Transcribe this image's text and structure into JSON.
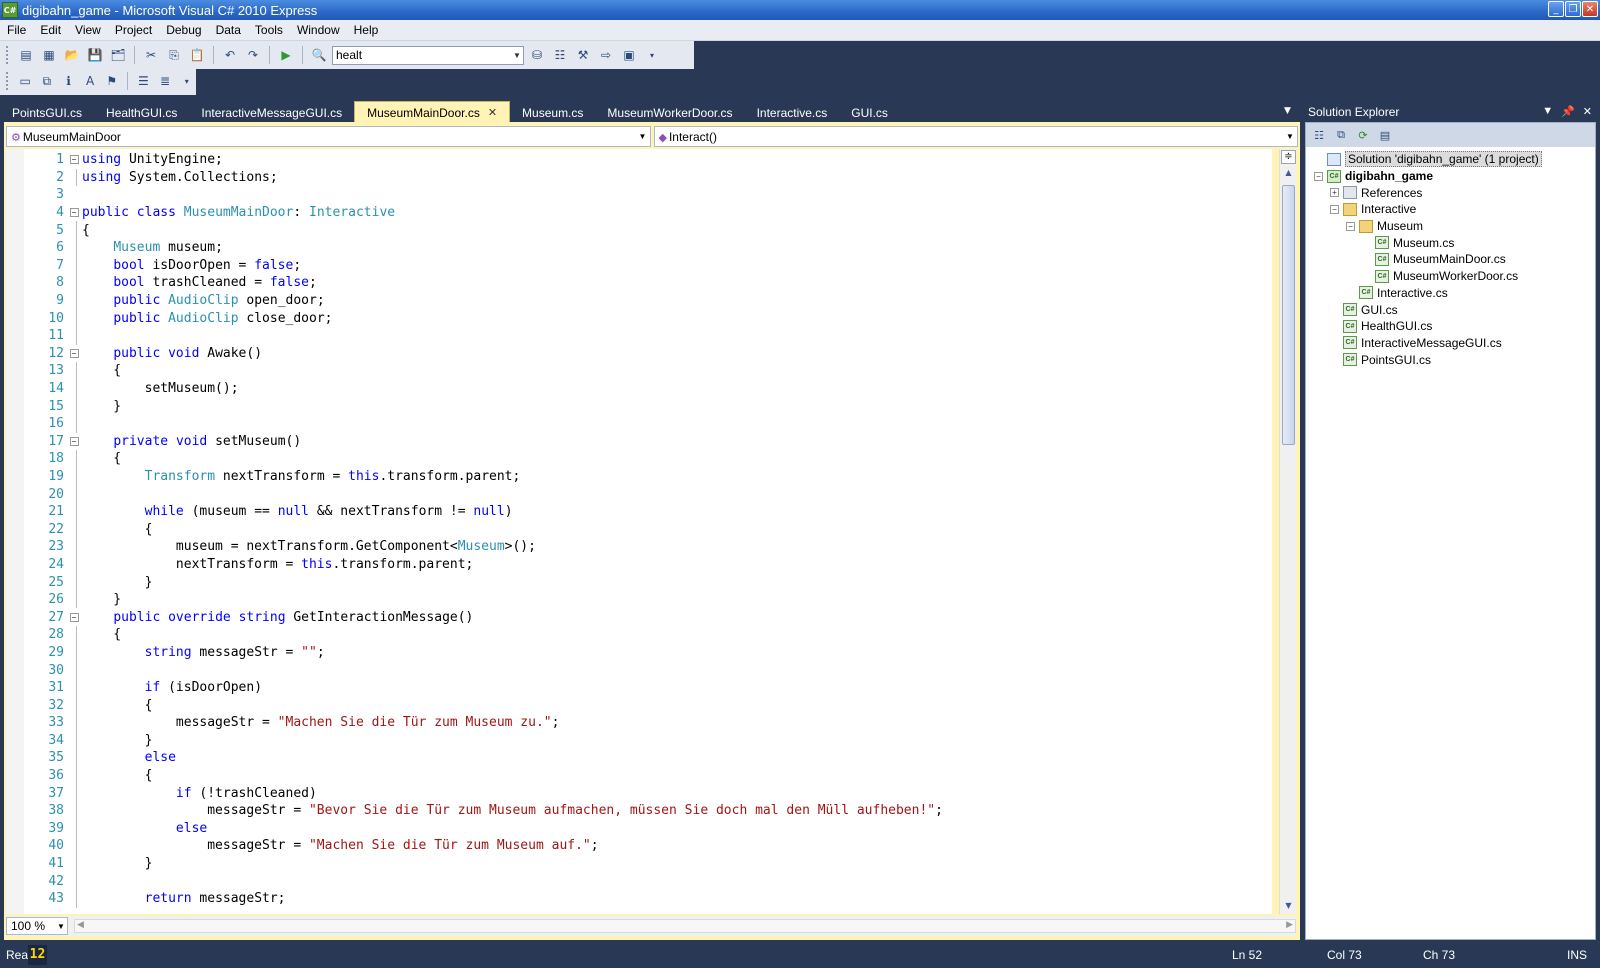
{
  "window": {
    "title": "digibahn_game - Microsoft Visual C# 2010 Express",
    "icon_label": "C#",
    "controls": [
      "minimize-icon",
      "maximize-icon",
      "close-icon"
    ]
  },
  "menu": [
    "File",
    "Edit",
    "View",
    "Project",
    "Debug",
    "Data",
    "Tools",
    "Window",
    "Help"
  ],
  "toolbar": {
    "find_combo_value": "healt"
  },
  "tabs": [
    {
      "label": "PointsGUI.cs",
      "active": false
    },
    {
      "label": "HealthGUI.cs",
      "active": false
    },
    {
      "label": "InteractiveMessageGUI.cs",
      "active": false
    },
    {
      "label": "MuseumMainDoor.cs",
      "active": true
    },
    {
      "label": "Museum.cs",
      "active": false
    },
    {
      "label": "MuseumWorkerDoor.cs",
      "active": false
    },
    {
      "label": "Interactive.cs",
      "active": false
    },
    {
      "label": "GUI.cs",
      "active": false
    }
  ],
  "navbar": {
    "type_combo": "MuseumMainDoor",
    "member_combo": "Interact()"
  },
  "colors": {
    "keyword": "#0000ff",
    "type": "#2b91af",
    "string": "#a31515",
    "line_number": "#2b91af",
    "chrome": "#293955",
    "active_tab": "#fff3b5"
  },
  "code": [
    {
      "n": "1",
      "fold": "box",
      "tokens": [
        {
          "t": "using",
          "c": "kw"
        },
        {
          "t": " UnityEngine;"
        }
      ]
    },
    {
      "n": "2",
      "fold": "line",
      "tokens": [
        {
          "t": "using",
          "c": "kw"
        },
        {
          "t": " System.Collections;"
        }
      ]
    },
    {
      "n": "3",
      "fold": "",
      "tokens": []
    },
    {
      "n": "4",
      "fold": "box",
      "tokens": [
        {
          "t": "public",
          "c": "kw"
        },
        {
          "t": " "
        },
        {
          "t": "class",
          "c": "kw"
        },
        {
          "t": " "
        },
        {
          "t": "MuseumMainDoor",
          "c": "ty"
        },
        {
          "t": ": "
        },
        {
          "t": "Interactive",
          "c": "ty"
        }
      ]
    },
    {
      "n": "5",
      "fold": "line",
      "tokens": [
        {
          "t": "{"
        }
      ]
    },
    {
      "n": "6",
      "fold": "line",
      "tokens": [
        {
          "t": "    "
        },
        {
          "t": "Museum",
          "c": "ty"
        },
        {
          "t": " museum;"
        }
      ]
    },
    {
      "n": "7",
      "fold": "line",
      "tokens": [
        {
          "t": "    "
        },
        {
          "t": "bool",
          "c": "kw"
        },
        {
          "t": " isDoorOpen = "
        },
        {
          "t": "false",
          "c": "kw"
        },
        {
          "t": ";"
        }
      ]
    },
    {
      "n": "8",
      "fold": "line",
      "tokens": [
        {
          "t": "    "
        },
        {
          "t": "bool",
          "c": "kw"
        },
        {
          "t": " trashCleaned = "
        },
        {
          "t": "false",
          "c": "kw"
        },
        {
          "t": ";"
        }
      ]
    },
    {
      "n": "9",
      "fold": "line",
      "tokens": [
        {
          "t": "    "
        },
        {
          "t": "public",
          "c": "kw"
        },
        {
          "t": " "
        },
        {
          "t": "AudioClip",
          "c": "ty"
        },
        {
          "t": " open_door;"
        }
      ]
    },
    {
      "n": "10",
      "fold": "line",
      "tokens": [
        {
          "t": "    "
        },
        {
          "t": "public",
          "c": "kw"
        },
        {
          "t": " "
        },
        {
          "t": "AudioClip",
          "c": "ty"
        },
        {
          "t": " close_door;"
        }
      ]
    },
    {
      "n": "11",
      "fold": "line",
      "tokens": []
    },
    {
      "n": "12",
      "fold": "box",
      "tokens": [
        {
          "t": "    "
        },
        {
          "t": "public",
          "c": "kw"
        },
        {
          "t": " "
        },
        {
          "t": "void",
          "c": "kw"
        },
        {
          "t": " Awake()"
        }
      ]
    },
    {
      "n": "13",
      "fold": "line",
      "tokens": [
        {
          "t": "    {"
        }
      ]
    },
    {
      "n": "14",
      "fold": "line",
      "tokens": [
        {
          "t": "        setMuseum();"
        }
      ]
    },
    {
      "n": "15",
      "fold": "line",
      "tokens": [
        {
          "t": "    }"
        }
      ]
    },
    {
      "n": "16",
      "fold": "line",
      "tokens": []
    },
    {
      "n": "17",
      "fold": "box",
      "tokens": [
        {
          "t": "    "
        },
        {
          "t": "private",
          "c": "kw"
        },
        {
          "t": " "
        },
        {
          "t": "void",
          "c": "kw"
        },
        {
          "t": " setMuseum()"
        }
      ]
    },
    {
      "n": "18",
      "fold": "line",
      "tokens": [
        {
          "t": "    {"
        }
      ]
    },
    {
      "n": "19",
      "fold": "line",
      "tokens": [
        {
          "t": "        "
        },
        {
          "t": "Transform",
          "c": "ty"
        },
        {
          "t": " nextTransform = "
        },
        {
          "t": "this",
          "c": "kw"
        },
        {
          "t": ".transform.parent;"
        }
      ]
    },
    {
      "n": "20",
      "fold": "line",
      "tokens": []
    },
    {
      "n": "21",
      "fold": "line",
      "tokens": [
        {
          "t": "        "
        },
        {
          "t": "while",
          "c": "kw"
        },
        {
          "t": " (museum == "
        },
        {
          "t": "null",
          "c": "kw"
        },
        {
          "t": " && nextTransform != "
        },
        {
          "t": "null",
          "c": "kw"
        },
        {
          "t": ")"
        }
      ]
    },
    {
      "n": "22",
      "fold": "line",
      "tokens": [
        {
          "t": "        {"
        }
      ]
    },
    {
      "n": "23",
      "fold": "line",
      "tokens": [
        {
          "t": "            museum = nextTransform.GetComponent<"
        },
        {
          "t": "Museum",
          "c": "ty"
        },
        {
          "t": ">();"
        }
      ]
    },
    {
      "n": "24",
      "fold": "line",
      "tokens": [
        {
          "t": "            nextTransform = "
        },
        {
          "t": "this",
          "c": "kw"
        },
        {
          "t": ".transform.parent;"
        }
      ]
    },
    {
      "n": "25",
      "fold": "line",
      "tokens": [
        {
          "t": "        }"
        }
      ]
    },
    {
      "n": "26",
      "fold": "line",
      "tokens": [
        {
          "t": "    }"
        }
      ]
    },
    {
      "n": "27",
      "fold": "box",
      "tokens": [
        {
          "t": "    "
        },
        {
          "t": "public",
          "c": "kw"
        },
        {
          "t": " "
        },
        {
          "t": "override",
          "c": "kw"
        },
        {
          "t": " "
        },
        {
          "t": "string",
          "c": "kw"
        },
        {
          "t": " GetInteractionMessage()"
        }
      ]
    },
    {
      "n": "28",
      "fold": "line",
      "tokens": [
        {
          "t": "    {"
        }
      ]
    },
    {
      "n": "29",
      "fold": "line",
      "tokens": [
        {
          "t": "        "
        },
        {
          "t": "string",
          "c": "kw"
        },
        {
          "t": " messageStr = "
        },
        {
          "t": "\"\"",
          "c": "st"
        },
        {
          "t": ";"
        }
      ]
    },
    {
      "n": "30",
      "fold": "line",
      "tokens": []
    },
    {
      "n": "31",
      "fold": "line",
      "tokens": [
        {
          "t": "        "
        },
        {
          "t": "if",
          "c": "kw"
        },
        {
          "t": " (isDoorOpen)"
        }
      ]
    },
    {
      "n": "32",
      "fold": "line",
      "tokens": [
        {
          "t": "        {"
        }
      ]
    },
    {
      "n": "33",
      "fold": "line",
      "tokens": [
        {
          "t": "            messageStr = "
        },
        {
          "t": "\"Machen Sie die Tür zum Museum zu.\"",
          "c": "st"
        },
        {
          "t": ";"
        }
      ]
    },
    {
      "n": "34",
      "fold": "line",
      "tokens": [
        {
          "t": "        }"
        }
      ]
    },
    {
      "n": "35",
      "fold": "line",
      "tokens": [
        {
          "t": "        "
        },
        {
          "t": "else",
          "c": "kw"
        }
      ]
    },
    {
      "n": "36",
      "fold": "line",
      "tokens": [
        {
          "t": "        {"
        }
      ]
    },
    {
      "n": "37",
      "fold": "line",
      "tokens": [
        {
          "t": "            "
        },
        {
          "t": "if",
          "c": "kw"
        },
        {
          "t": " (!trashCleaned)"
        }
      ]
    },
    {
      "n": "38",
      "fold": "line",
      "tokens": [
        {
          "t": "                messageStr = "
        },
        {
          "t": "\"Bevor Sie die Tür zum Museum aufmachen, müssen Sie doch mal den Müll aufheben!\"",
          "c": "st"
        },
        {
          "t": ";"
        }
      ]
    },
    {
      "n": "39",
      "fold": "line",
      "tokens": [
        {
          "t": "            "
        },
        {
          "t": "else",
          "c": "kw"
        }
      ]
    },
    {
      "n": "40",
      "fold": "line",
      "tokens": [
        {
          "t": "                messageStr = "
        },
        {
          "t": "\"Machen Sie die Tür zum Museum auf.\"",
          "c": "st"
        },
        {
          "t": ";"
        }
      ]
    },
    {
      "n": "41",
      "fold": "line",
      "tokens": [
        {
          "t": "        }"
        }
      ]
    },
    {
      "n": "42",
      "fold": "line",
      "tokens": []
    },
    {
      "n": "43",
      "fold": "line",
      "tokens": [
        {
          "t": "        "
        },
        {
          "t": "return",
          "c": "kw"
        },
        {
          "t": " messageStr;"
        }
      ]
    }
  ],
  "editor": {
    "zoom": "100 %"
  },
  "solution_explorer": {
    "title": "Solution Explorer",
    "items": [
      {
        "label": "Solution 'digibahn_game' (1 project)",
        "depth": 0,
        "icon": "solution",
        "exp": "",
        "selected": true,
        "bold": false
      },
      {
        "label": "digibahn_game",
        "depth": 0,
        "icon": "project",
        "exp": "−",
        "selected": false,
        "bold": true
      },
      {
        "label": "References",
        "depth": 1,
        "icon": "refs",
        "exp": "+",
        "selected": false,
        "bold": false
      },
      {
        "label": "Interactive",
        "depth": 1,
        "icon": "folder",
        "exp": "−",
        "selected": false,
        "bold": false
      },
      {
        "label": "Museum",
        "depth": 2,
        "icon": "folder",
        "exp": "−",
        "selected": false,
        "bold": false
      },
      {
        "label": "Museum.cs",
        "depth": 3,
        "icon": "cs",
        "exp": "",
        "selected": false,
        "bold": false
      },
      {
        "label": "MuseumMainDoor.cs",
        "depth": 3,
        "icon": "cs",
        "exp": "",
        "selected": false,
        "bold": false
      },
      {
        "label": "MuseumWorkerDoor.cs",
        "depth": 3,
        "icon": "cs",
        "exp": "",
        "selected": false,
        "bold": false
      },
      {
        "label": "Interactive.cs",
        "depth": 2,
        "icon": "cs",
        "exp": "",
        "selected": false,
        "bold": false
      },
      {
        "label": "GUI.cs",
        "depth": 1,
        "icon": "cs",
        "exp": "",
        "selected": false,
        "bold": false
      },
      {
        "label": "HealthGUI.cs",
        "depth": 1,
        "icon": "cs",
        "exp": "",
        "selected": false,
        "bold": false
      },
      {
        "label": "InteractiveMessageGUI.cs",
        "depth": 1,
        "icon": "cs",
        "exp": "",
        "selected": false,
        "bold": false
      },
      {
        "label": "PointsGUI.cs",
        "depth": 1,
        "icon": "cs",
        "exp": "",
        "selected": false,
        "bold": false
      }
    ]
  },
  "status": {
    "left": "Read",
    "ln": "Ln 52",
    "col": "Col 73",
    "ch": "Ch 73",
    "mode": "INS"
  }
}
